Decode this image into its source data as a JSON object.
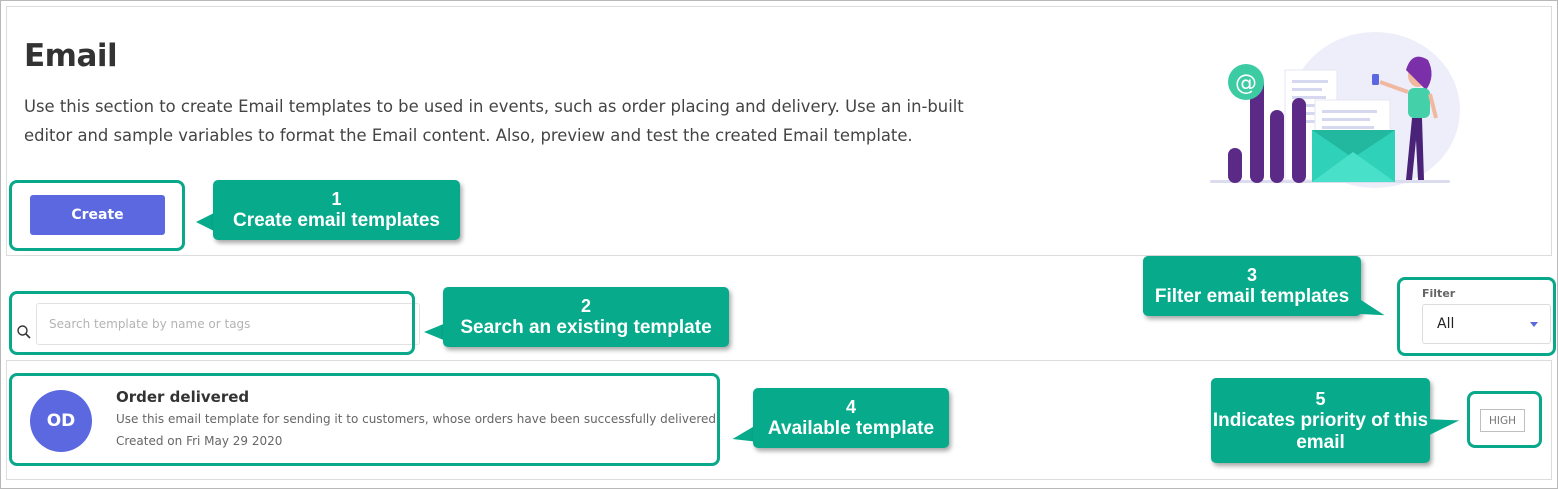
{
  "page": {
    "title": "Email",
    "description": "Use this section to create Email templates to be used in events, such as order placing and delivery. Use an in-built editor and sample variables to format the Email content. Also, preview and test the created Email template."
  },
  "toolbar": {
    "create_label": "Create"
  },
  "search": {
    "placeholder": "Search template by name or tags"
  },
  "filter": {
    "label": "Filter",
    "selected": "All"
  },
  "templates": [
    {
      "initials": "OD",
      "name": "Order delivered",
      "description": "Use this email template for sending it to customers, whose orders have been successfully delivered.",
      "created": "Created on Fri May 29 2020",
      "priority": "HIGH"
    }
  ],
  "callouts": [
    {
      "num": "1",
      "text": "Create email templates"
    },
    {
      "num": "2",
      "text": "Search an existing template"
    },
    {
      "num": "3",
      "text": "Filter email templates"
    },
    {
      "num": "4",
      "text": "Available template"
    },
    {
      "num": "5",
      "text": "Indicates priority of this email"
    }
  ],
  "colors": {
    "accent": "#5b68e0",
    "callout": "#07ab8c",
    "highlight": "#0aa88a"
  }
}
